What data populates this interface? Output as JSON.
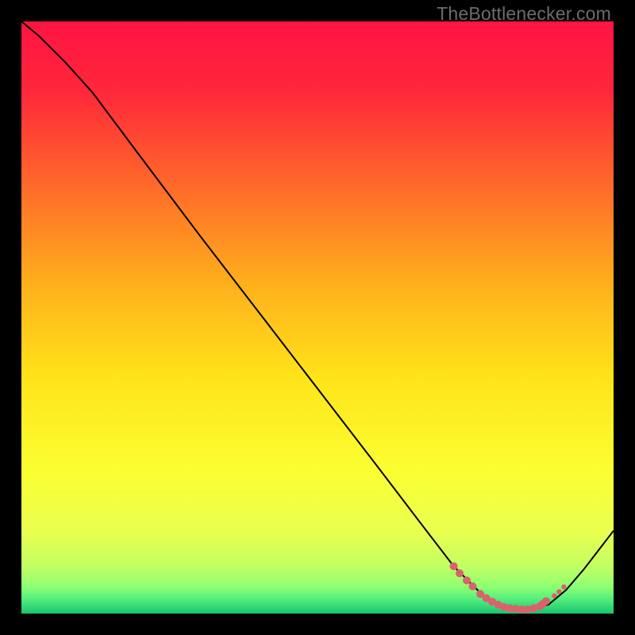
{
  "watermark": "TheBottlenecker.com",
  "chart_data": {
    "type": "line",
    "title": "",
    "xlabel": "",
    "ylabel": "",
    "xlim": [
      0,
      100
    ],
    "ylim": [
      0,
      100
    ],
    "grid": false,
    "legend": false,
    "background_gradient": [
      {
        "pos": 0.0,
        "color": "#ff1343"
      },
      {
        "pos": 0.12,
        "color": "#ff283a"
      },
      {
        "pos": 0.25,
        "color": "#ff5e2c"
      },
      {
        "pos": 0.44,
        "color": "#ffae1c"
      },
      {
        "pos": 0.6,
        "color": "#ffe31a"
      },
      {
        "pos": 0.76,
        "color": "#fbff32"
      },
      {
        "pos": 0.86,
        "color": "#eaff4f"
      },
      {
        "pos": 0.92,
        "color": "#c3ff62"
      },
      {
        "pos": 0.955,
        "color": "#8dff72"
      },
      {
        "pos": 0.975,
        "color": "#55ef7d"
      },
      {
        "pos": 1.0,
        "color": "#19c56f"
      }
    ],
    "series": [
      {
        "name": "bottleneck-curve",
        "stroke": "#000000",
        "stroke_width": 2.0,
        "x": [
          0.0,
          3.0,
          7.5,
          12.0,
          20.0,
          30.0,
          40.0,
          50.0,
          60.0,
          68.0,
          73.0,
          78.0,
          80.5,
          85.0,
          89.0,
          92.0,
          95.0,
          100.0
        ],
        "y": [
          100.0,
          97.5,
          93.0,
          88.0,
          77.3,
          64.0,
          51.0,
          38.0,
          25.0,
          14.5,
          8.0,
          3.0,
          1.5,
          0.7,
          1.5,
          4.0,
          7.5,
          14.0
        ]
      }
    ],
    "markers": {
      "name": "dense-bottom-band",
      "color": "#d8636c",
      "radius_main": 5,
      "radius_small": 3.2,
      "x": [
        73.0,
        74.0,
        75.2,
        76.2,
        77.5,
        78.5,
        79.5,
        80.5,
        81.5,
        82.5,
        83.5,
        84.5,
        85.5,
        86.5,
        87.5,
        88.0,
        88.6,
        90.0,
        90.8,
        91.6
      ],
      "y": [
        8.0,
        6.8,
        5.6,
        4.6,
        3.3,
        2.6,
        2.0,
        1.5,
        1.1,
        0.9,
        0.8,
        0.7,
        0.7,
        0.9,
        1.2,
        1.6,
        2.1,
        3.0,
        3.7,
        4.5
      ],
      "small_idx": [
        17,
        18,
        19
      ]
    }
  }
}
